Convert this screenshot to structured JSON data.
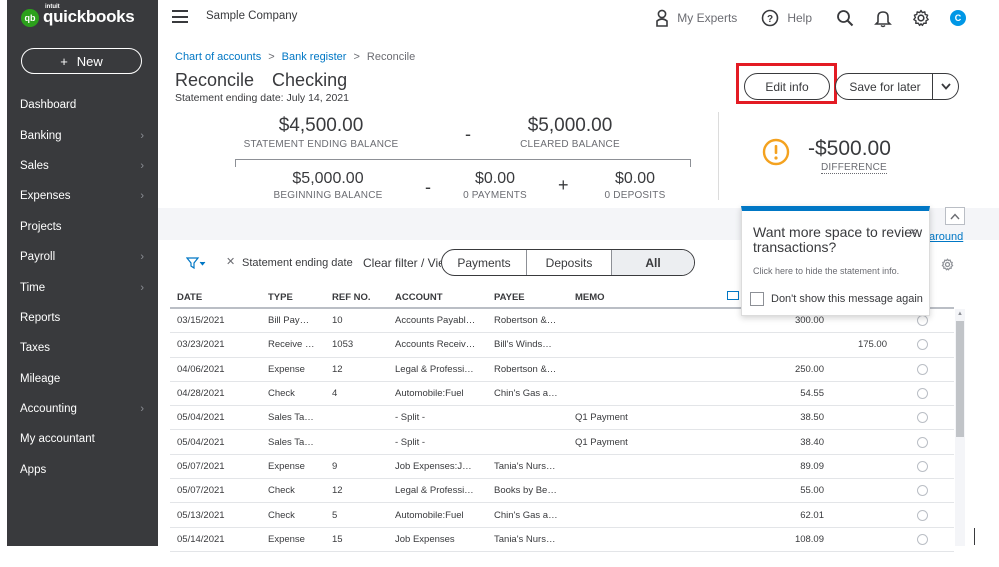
{
  "app": {
    "brand_small": "intuit",
    "brand": "quickbooks",
    "logo_mark": "qb",
    "company": "Sample Company",
    "avatar_initial": "C"
  },
  "sidebar": {
    "new_label": "New",
    "items": [
      {
        "label": "Dashboard",
        "chevron": false
      },
      {
        "label": "Banking",
        "chevron": true
      },
      {
        "label": "Sales",
        "chevron": true
      },
      {
        "label": "Expenses",
        "chevron": true
      },
      {
        "label": "Projects",
        "chevron": false
      },
      {
        "label": "Payroll",
        "chevron": true
      },
      {
        "label": "Time",
        "chevron": true
      },
      {
        "label": "Reports",
        "chevron": false
      },
      {
        "label": "Taxes",
        "chevron": false
      },
      {
        "label": "Mileage",
        "chevron": false
      },
      {
        "label": "Accounting",
        "chevron": true
      },
      {
        "label": "My accountant",
        "chevron": false
      },
      {
        "label": "Apps",
        "chevron": false
      }
    ]
  },
  "topbar": {
    "my_experts": "My Experts",
    "help": "Help"
  },
  "header": {
    "breadcrumb": [
      "Chart of accounts",
      "Bank register",
      "Reconcile"
    ],
    "title": "Reconcile",
    "account": "Checking",
    "statement_date": "Statement ending date: July 14, 2021",
    "edit_info": "Edit info",
    "save_for_later": "Save for later"
  },
  "summary": {
    "statement_ending_balance": "$4,500.00",
    "statement_ending_label": "STATEMENT ENDING BALANCE",
    "minus1": "-",
    "cleared_balance": "$5,000.00",
    "cleared_label": "CLEARED BALANCE",
    "beginning_balance": "$5,000.00",
    "beginning_label": "BEGINNING BALANCE",
    "minus2": "-",
    "payments": "$0.00",
    "payments_label": "0 PAYMENTS",
    "plus": "+",
    "deposits": "$0.00",
    "deposits_label": "0 DEPOSITS",
    "difference": "-$500.00",
    "difference_label": "DIFFERENCE"
  },
  "filters": {
    "chip": "Statement ending date",
    "clear": "Clear filter / View all",
    "tabs": [
      "Payments",
      "Deposits",
      "All"
    ],
    "active_tab": "All",
    "behind_link": "around"
  },
  "popup": {
    "title": "Want more space to review transactions?",
    "desc": "Click here to hide the statement info.",
    "checkbox": "Don't show this message again",
    "close": "×"
  },
  "table": {
    "headers": [
      "DATE",
      "TYPE",
      "REF NO.",
      "ACCOUNT",
      "PAYEE",
      "MEMO"
    ],
    "rows": [
      {
        "date": "03/15/2021",
        "type": "Bill Pay…",
        "ref": "10",
        "account": "Accounts Payabl…",
        "payee": "Robertson &…",
        "memo": "",
        "payment": "300.00",
        "deposit": ""
      },
      {
        "date": "03/23/2021",
        "type": "Receive …",
        "ref": "1053",
        "account": "Accounts Receiv…",
        "payee": "Bill's Winds…",
        "memo": "",
        "payment": "",
        "deposit": "175.00"
      },
      {
        "date": "04/06/2021",
        "type": "Expense",
        "ref": "12",
        "account": "Legal & Professi…",
        "payee": "Robertson &…",
        "memo": "",
        "payment": "250.00",
        "deposit": ""
      },
      {
        "date": "04/28/2021",
        "type": "Check",
        "ref": "4",
        "account": "Automobile:Fuel",
        "payee": "Chin's Gas a…",
        "memo": "",
        "payment": "54.55",
        "deposit": ""
      },
      {
        "date": "05/04/2021",
        "type": "Sales Ta…",
        "ref": "",
        "account": "- Split -",
        "payee": "",
        "memo": "Q1 Payment",
        "payment": "38.50",
        "deposit": ""
      },
      {
        "date": "05/04/2021",
        "type": "Sales Ta…",
        "ref": "",
        "account": "- Split -",
        "payee": "",
        "memo": "Q1 Payment",
        "payment": "38.40",
        "deposit": ""
      },
      {
        "date": "05/07/2021",
        "type": "Expense",
        "ref": "9",
        "account": "Job Expenses:J…",
        "payee": "Tania's Nurs…",
        "memo": "",
        "payment": "89.09",
        "deposit": ""
      },
      {
        "date": "05/07/2021",
        "type": "Check",
        "ref": "12",
        "account": "Legal & Professi…",
        "payee": "Books by Be…",
        "memo": "",
        "payment": "55.00",
        "deposit": ""
      },
      {
        "date": "05/13/2021",
        "type": "Check",
        "ref": "5",
        "account": "Automobile:Fuel",
        "payee": "Chin's Gas a…",
        "memo": "",
        "payment": "62.01",
        "deposit": ""
      },
      {
        "date": "05/14/2021",
        "type": "Expense",
        "ref": "15",
        "account": "Job Expenses",
        "payee": "Tania's Nurs…",
        "memo": "",
        "payment": "108.09",
        "deposit": ""
      }
    ]
  },
  "colors": {
    "sidebar": "#393a3d",
    "brand_green": "#2ca01c",
    "link_blue": "#0077c5",
    "highlight_red": "#e31b23",
    "warning_orange": "#f4a21f"
  }
}
